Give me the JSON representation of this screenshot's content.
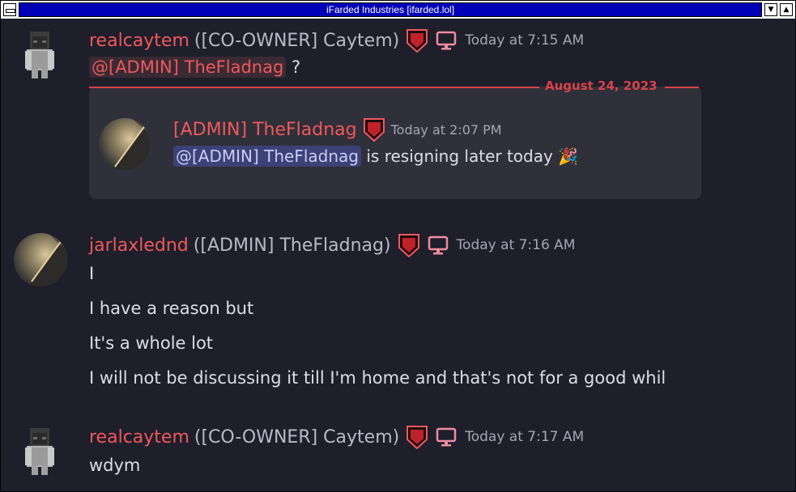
{
  "window": {
    "title": "iFarded Industries [ifarded.lol]"
  },
  "messages": [
    {
      "username": "realcaytem",
      "nickname": "([CO-OWNER] Caytem)",
      "timestamp": "Today at 7:15 AM",
      "mention": "@[ADMIN] TheFladnag",
      "after_mention": "?"
    },
    {
      "username": "jarlaxlednd",
      "nickname": "([ADMIN] TheFladnag)",
      "timestamp": "Today at 7:16 AM",
      "lines": [
        "I",
        "I have a reason but",
        "It's a whole lot",
        "I will not be discussing it till I'm home and that's not for a good whil"
      ]
    },
    {
      "username": "realcaytem",
      "nickname": "([CO-OWNER] Caytem)",
      "timestamp": "Today at 7:17 AM",
      "text": "wdym"
    }
  ],
  "reply": {
    "date_divider": "August 24, 2023",
    "author": "[ADMIN] TheFladnag",
    "timestamp": "Today at 2:07 PM",
    "mention": "@[ADMIN] TheFladnag",
    "text": "is resigning later today",
    "emoji": "🎉"
  },
  "colors": {
    "accent_red": "#f0585c",
    "background": "#1e1f2b",
    "title_bar": "#0000b8"
  }
}
